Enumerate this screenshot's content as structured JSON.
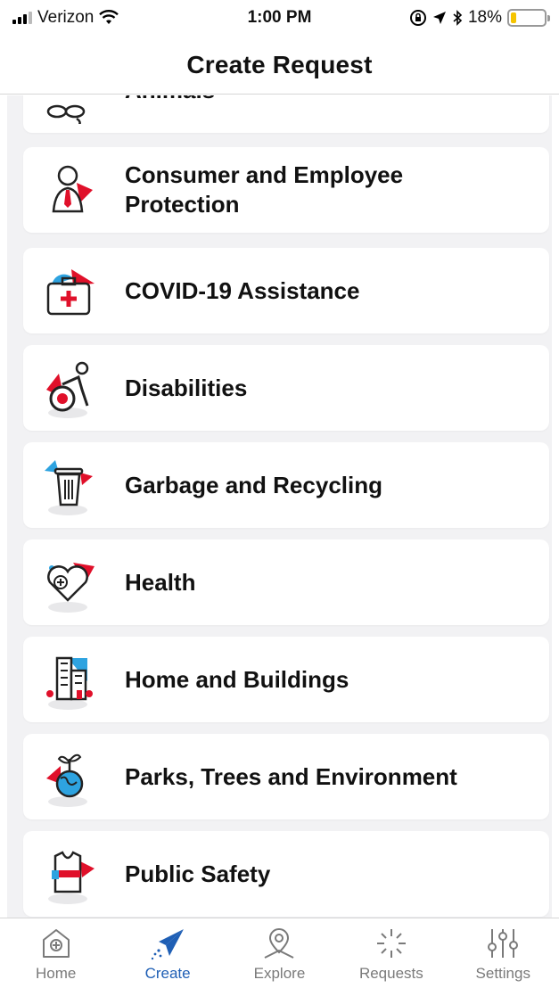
{
  "status": {
    "carrier": "Verizon",
    "time": "1:00 PM",
    "battery": "18%",
    "battery_level": 0.18
  },
  "nav": {
    "title": "Create Request"
  },
  "categories": [
    {
      "label": "Animals",
      "icon": "animals-icon"
    },
    {
      "label": "Consumer and Employee Protection",
      "icon": "person-tie-icon"
    },
    {
      "label": "COVID-19 Assistance",
      "icon": "first-aid-kit-icon"
    },
    {
      "label": "Disabilities",
      "icon": "accessibility-icon"
    },
    {
      "label": "Garbage and Recycling",
      "icon": "trash-can-icon"
    },
    {
      "label": "Health",
      "icon": "heart-icon"
    },
    {
      "label": "Home and Buildings",
      "icon": "buildings-icon"
    },
    {
      "label": "Parks, Trees and Environment",
      "icon": "globe-plant-icon"
    },
    {
      "label": "Public Safety",
      "icon": "safety-vest-icon"
    }
  ],
  "tabs": [
    {
      "label": "Home",
      "icon": "home-icon",
      "active": false
    },
    {
      "label": "Create",
      "icon": "paper-plane-icon",
      "active": true
    },
    {
      "label": "Explore",
      "icon": "map-pin-icon",
      "active": false
    },
    {
      "label": "Requests",
      "icon": "sun-burst-icon",
      "active": false
    },
    {
      "label": "Settings",
      "icon": "sliders-icon",
      "active": false
    }
  ],
  "colors": {
    "accent": "#1f5fb5",
    "red": "#e0102a",
    "blue": "#2ea3e0",
    "background": "#f2f2f4"
  }
}
